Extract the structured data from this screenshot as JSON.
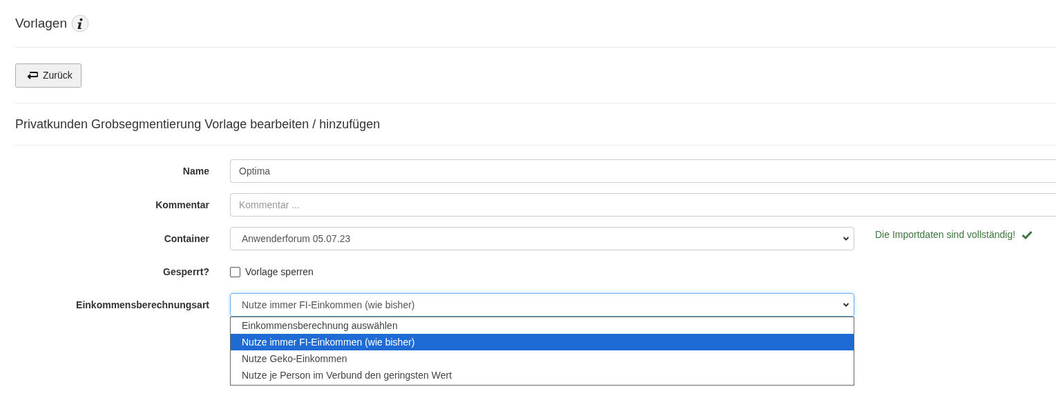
{
  "page_title": "Vorlagen",
  "back_button": "Zurück",
  "section_title": "Privatkunden Grobsegmentierung Vorlage bearbeiten / hinzufügen",
  "fields": [
    {
      "kind": "text",
      "label": "Name",
      "value": "Optima"
    },
    {
      "kind": "text",
      "label": "Kommentar",
      "placeholder": "Kommentar ..."
    },
    {
      "kind": "select",
      "label": "Container",
      "value": "Anwenderforum 05.07.23",
      "status": "Die Importdaten sind vollständig!"
    },
    {
      "kind": "checkbox",
      "label": "Gesperrt?",
      "option": "Vorlage sperren",
      "checked": false
    },
    {
      "kind": "select",
      "label": "Einkommensberechnungsart",
      "value": "Nutze immer FI-Einkommen (wie bisher)",
      "expanded": true,
      "options": [
        {
          "label": "Einkommensberechnung auswählen",
          "selected": false
        },
        {
          "label": "Nutze immer FI-Einkommen (wie bisher)",
          "selected": true
        },
        {
          "label": "Nutze Geko-Einkommen",
          "selected": false
        },
        {
          "label": "Nutze je Person im Verbund den geringsten Wert",
          "selected": false
        }
      ]
    }
  ]
}
